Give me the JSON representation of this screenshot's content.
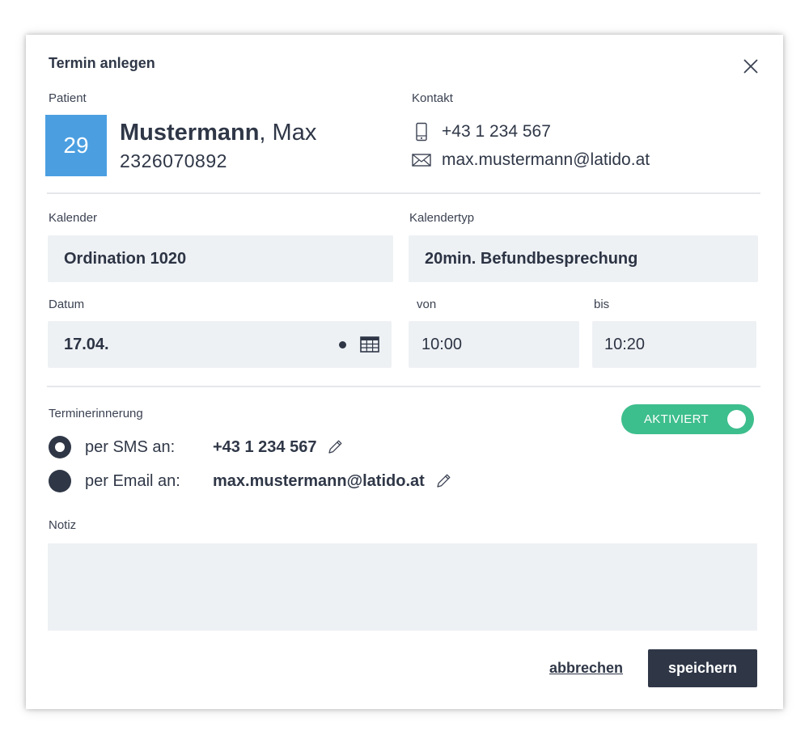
{
  "dialog": {
    "title": "Termin anlegen"
  },
  "patient": {
    "label": "Patient",
    "avatar_text": "29",
    "last_name": "Mustermann",
    "first_name": ", Max",
    "number": "2326070892"
  },
  "contact": {
    "label": "Kontakt",
    "phone": "+43 1 234 567",
    "email": "max.mustermann@latido.at"
  },
  "calendar": {
    "label": "Kalender",
    "value": "Ordination 1020",
    "type_label": "Kalendertyp",
    "type_value": "20min. Befundbesprechung"
  },
  "date": {
    "label": "Datum",
    "value": "17.04.",
    "from_label": "von",
    "from_value": "10:00",
    "to_label": "bis",
    "to_value": "10:20"
  },
  "reminder": {
    "label": "Terminerinnerung",
    "toggle_label": "AKTIVIERT",
    "sms_label": "per SMS an:",
    "sms_value": "+43 1 234 567",
    "email_label": "per Email an:",
    "email_value": "max.mustermann@latido.at"
  },
  "note": {
    "label": "Notiz",
    "value": ""
  },
  "actions": {
    "cancel": "abbrechen",
    "save": "speichern"
  },
  "colors": {
    "accent_blue": "#4b9fe1",
    "toggle_green": "#3dbe8d",
    "dark": "#2f3747",
    "field_bg": "#eef1f4"
  },
  "icons": {
    "close": "close-icon",
    "phone": "mobile-phone-icon",
    "email": "envelope-icon",
    "calendar": "calendar-icon",
    "edit": "pencil-icon"
  }
}
